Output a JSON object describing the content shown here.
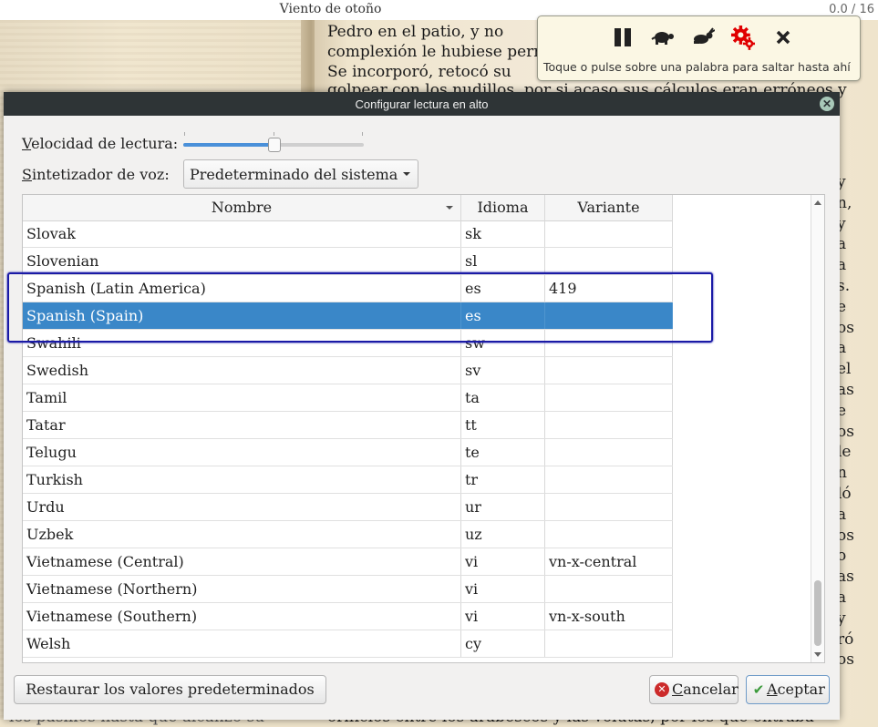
{
  "reader": {
    "book_title": "Viento de otoño",
    "page_counter": "0.0 / 16",
    "right_page_lines": [
      "Pedro en el patio, y no",
      "complexión le hubiese perr",
      "    Se incorporó, retocó su",
      "golpear con los nudillos, por si acaso sus cálculos eran erróneos y"
    ],
    "bottom_left_text": "los pasillos hasta que alcanzó su",
    "bottom_right_text": "orificios entre los arabescos y las volutas, por los que entraba",
    "right_edge_fragments": [
      "y",
      "n,",
      "y",
      "a",
      "a",
      "s.",
      "e",
      "os",
      "a",
      "el",
      "as",
      "e",
      "os",
      "le",
      "n",
      "ló",
      "a",
      "os",
      "o",
      "as",
      "a",
      "y",
      "ró",
      "os"
    ]
  },
  "tts_toolbar": {
    "icons": [
      "pause-icon",
      "turtle-slow-icon",
      "rabbit-fast-icon",
      "gears-settings-icon",
      "close-icon"
    ],
    "hint": "Toque o pulse sobre una palabra para saltar hasta ahí",
    "accent_color": "#e00000"
  },
  "dialog": {
    "title": "Configurar lectura en alto",
    "speed_label_prefix": "V",
    "speed_label_rest": "elocidad de lectura:",
    "speed_fraction": 0.5,
    "synth_label_prefix": "S",
    "synth_label_rest": "intetizador de voz:",
    "synth_value": "Predeterminado del sistema",
    "columns": [
      "Nombre",
      "Idioma",
      "Variante"
    ],
    "rows": [
      {
        "name": "Slovak",
        "lang": "sk",
        "variant": ""
      },
      {
        "name": "Slovenian",
        "lang": "sl",
        "variant": ""
      },
      {
        "name": "Spanish (Latin America)",
        "lang": "es",
        "variant": "419"
      },
      {
        "name": "Spanish (Spain)",
        "lang": "es",
        "variant": "",
        "selected": true
      },
      {
        "name": "Swahili",
        "lang": "sw",
        "variant": ""
      },
      {
        "name": "Swedish",
        "lang": "sv",
        "variant": ""
      },
      {
        "name": "Tamil",
        "lang": "ta",
        "variant": ""
      },
      {
        "name": "Tatar",
        "lang": "tt",
        "variant": ""
      },
      {
        "name": "Telugu",
        "lang": "te",
        "variant": ""
      },
      {
        "name": "Turkish",
        "lang": "tr",
        "variant": ""
      },
      {
        "name": "Urdu",
        "lang": "ur",
        "variant": ""
      },
      {
        "name": "Uzbek",
        "lang": "uz",
        "variant": ""
      },
      {
        "name": "Vietnamese (Central)",
        "lang": "vi",
        "variant": "vn-x-central"
      },
      {
        "name": "Vietnamese (Northern)",
        "lang": "vi",
        "variant": ""
      },
      {
        "name": "Vietnamese (Southern)",
        "lang": "vi",
        "variant": "vn-x-south"
      },
      {
        "name": "Welsh",
        "lang": "cy",
        "variant": ""
      }
    ],
    "buttons": {
      "restore": "Restaurar los valores predeterminados",
      "cancel_prefix": "C",
      "cancel_rest": "ancelar",
      "accept_prefix": "A",
      "accept_rest": "ceptar"
    },
    "selection_color": "#3a87c8",
    "highlight_color": "#1a1aa6"
  }
}
